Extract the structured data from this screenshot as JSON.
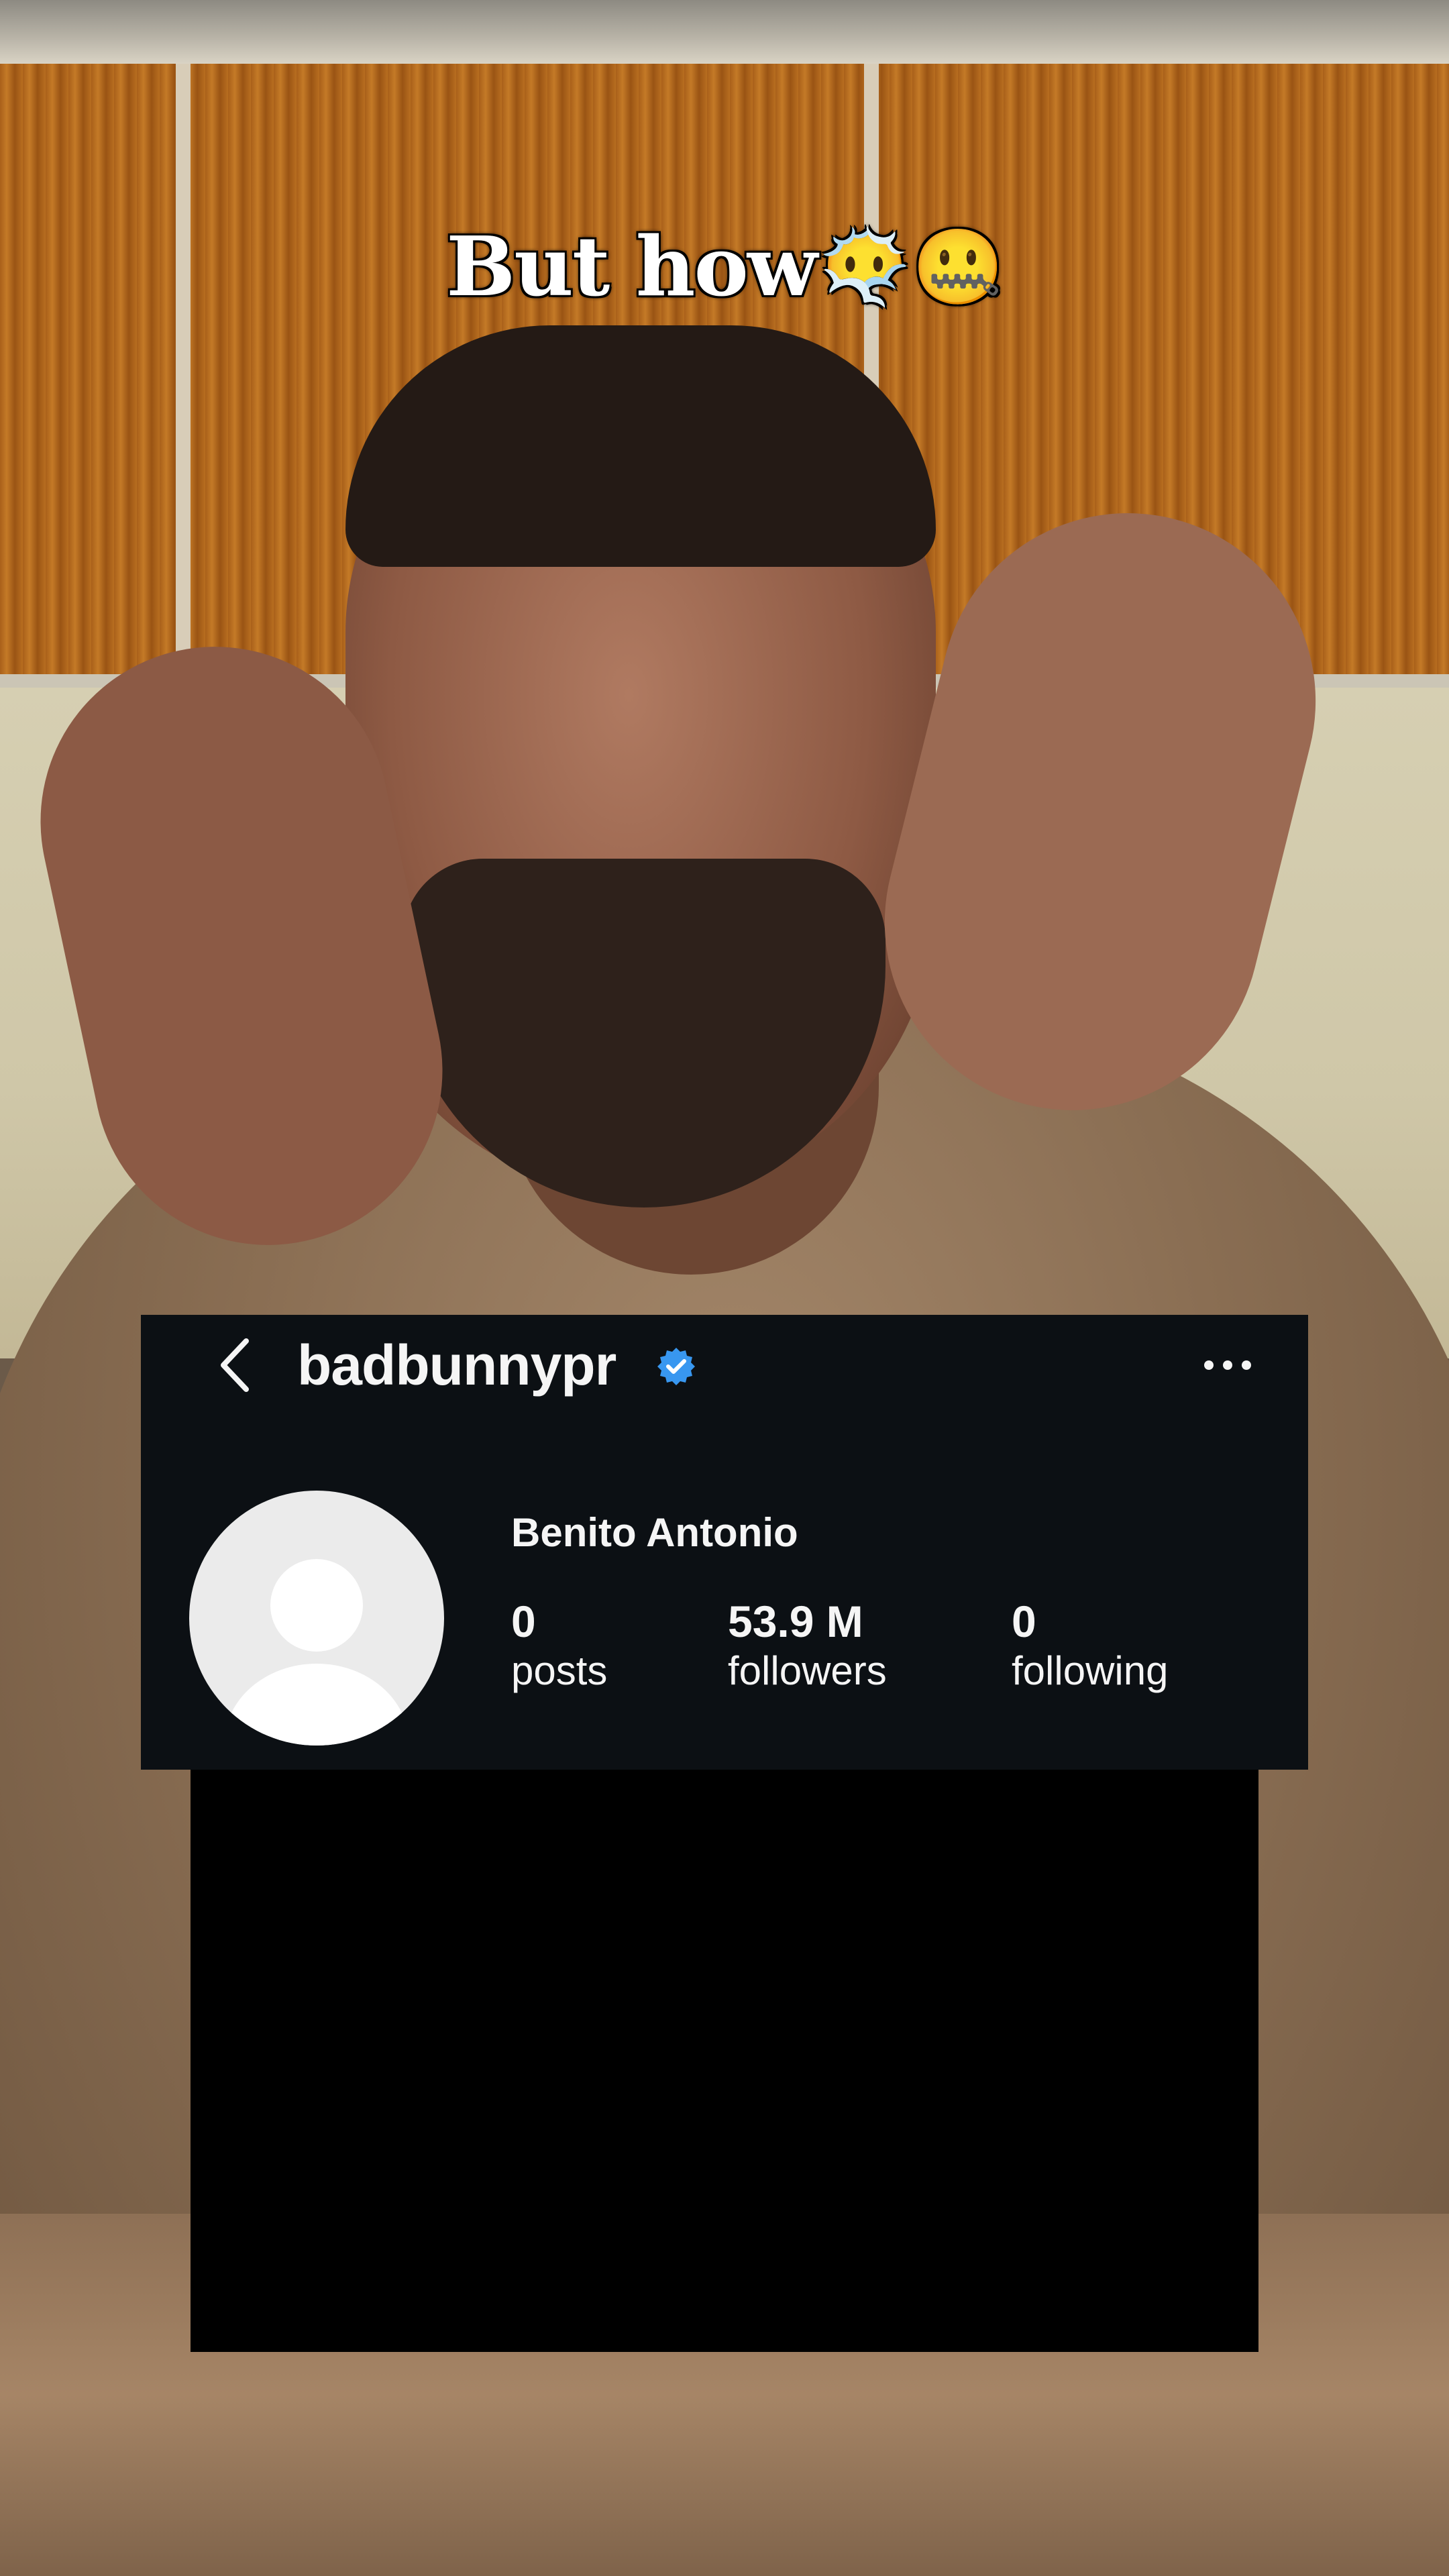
{
  "caption": {
    "text": "But how",
    "emoji_1": "😶‍🌫️",
    "emoji_2": "🤐"
  },
  "profile": {
    "username": "badbunnypr",
    "verified": true,
    "display_name": "Benito Antonio",
    "stats": [
      {
        "value": "0",
        "label": "posts"
      },
      {
        "value": "53.9 M",
        "label": "followers"
      },
      {
        "value": "0",
        "label": "following"
      }
    ]
  },
  "colors": {
    "card_background": "#0c1014",
    "verified_blue": "#3897f0",
    "text": "#f5f5f5",
    "avatar_placeholder": "#ebebeb"
  },
  "icons": [
    "back-chevron-icon",
    "verified-badge-icon",
    "more-options-icon",
    "default-avatar-icon"
  ]
}
